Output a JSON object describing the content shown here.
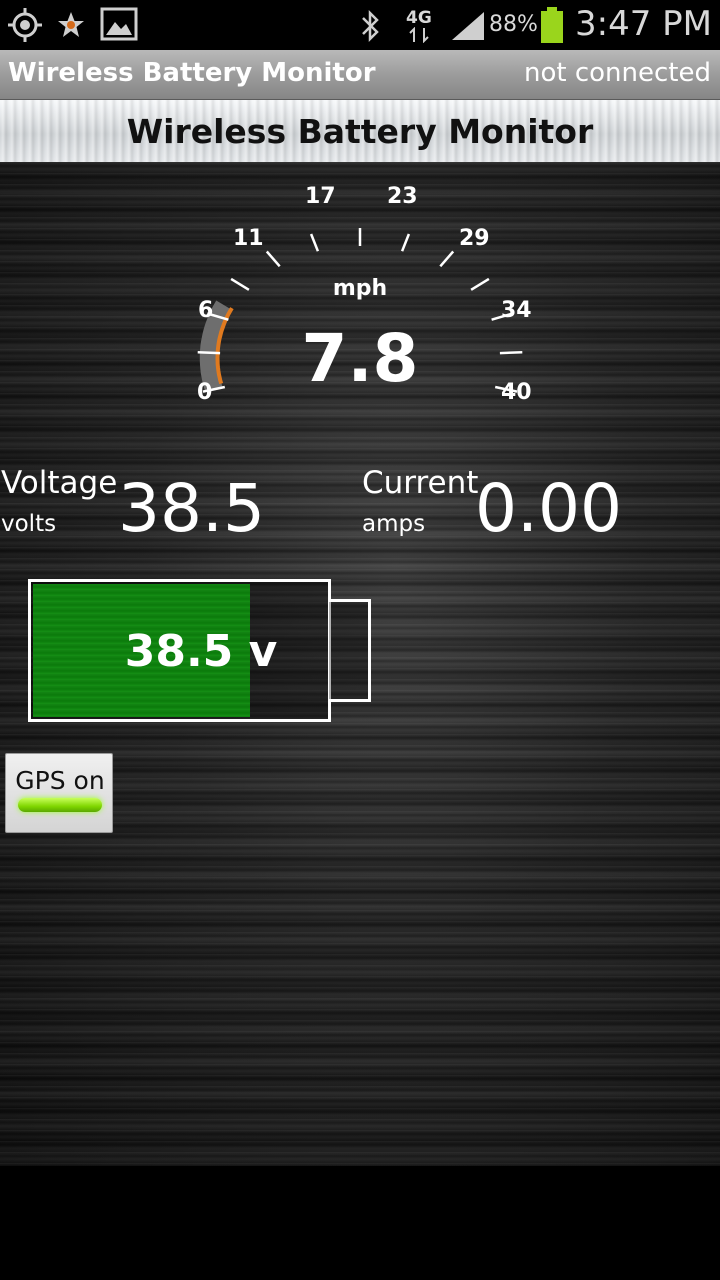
{
  "status_bar": {
    "icons": [
      "location-target-icon",
      "star-icon",
      "image-icon",
      "bluetooth-icon",
      "network-4g-icon",
      "signal-icon",
      "battery-charging-icon"
    ],
    "network": "4G",
    "battery_percent": "88%",
    "time": "3:47 PM",
    "battery_color": "#9ad51c"
  },
  "title_bar": {
    "app_title": "Wireless Battery Monitor",
    "connection_status": "not connected"
  },
  "banner": {
    "heading": "Wireless Battery Monitor"
  },
  "gauge": {
    "unit": "mph",
    "value": "7.8",
    "speed": 7.8,
    "min": 0,
    "max": 40,
    "tick_labels": [
      "0",
      "6",
      "11",
      "17",
      "23",
      "29",
      "34",
      "40"
    ],
    "needle_color": "#e07a1f"
  },
  "voltage": {
    "label": "Voltage",
    "unit": "volts",
    "value": "38.5"
  },
  "current": {
    "label": "Current",
    "unit": "amps",
    "value": "0.00"
  },
  "battery_indicator": {
    "text": "38.5 v",
    "fill_fraction": 0.74,
    "fill_color": "#138513"
  },
  "gps_button": {
    "label": "GPS on",
    "state": "on",
    "indicator_color": "#7fd600"
  }
}
